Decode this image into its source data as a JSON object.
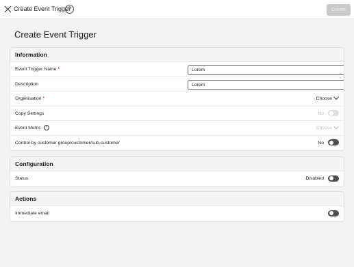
{
  "header": {
    "close_icon": "close-icon",
    "title": "Create Event Trigger",
    "help_glyph": "?",
    "create_label": "Create"
  },
  "page": {
    "title": "Create Event Trigger"
  },
  "sections": {
    "information": {
      "title": "Information",
      "event_trigger_name": {
        "label": "Event Trigger Name",
        "required_mark": "*",
        "value": "Lorem"
      },
      "description": {
        "label": "Description",
        "value": "Lorem"
      },
      "organisation": {
        "label": "Organisation",
        "required_mark": "*",
        "value": "Choose"
      },
      "copy_settings": {
        "label": "Copy Settings",
        "value": "No",
        "enabled": false
      },
      "event_metric": {
        "label": "Event Metric",
        "info_glyph": "i",
        "value": "Choose",
        "enabled": false
      },
      "control_by_customer": {
        "label": "Control by customer group/customer/sub-customer",
        "value": "No",
        "enabled": true
      }
    },
    "configuration": {
      "title": "Configuration",
      "status": {
        "label": "Status",
        "value": "Disabled"
      }
    },
    "actions": {
      "title": "Actions",
      "immediate_email": {
        "label": "Immediate email"
      }
    }
  },
  "colors": {
    "toggle_off": "#4a4d4e",
    "required": "#e60000",
    "disabled_text": "#bbbbbb",
    "create_button": "#c9c9c9"
  }
}
